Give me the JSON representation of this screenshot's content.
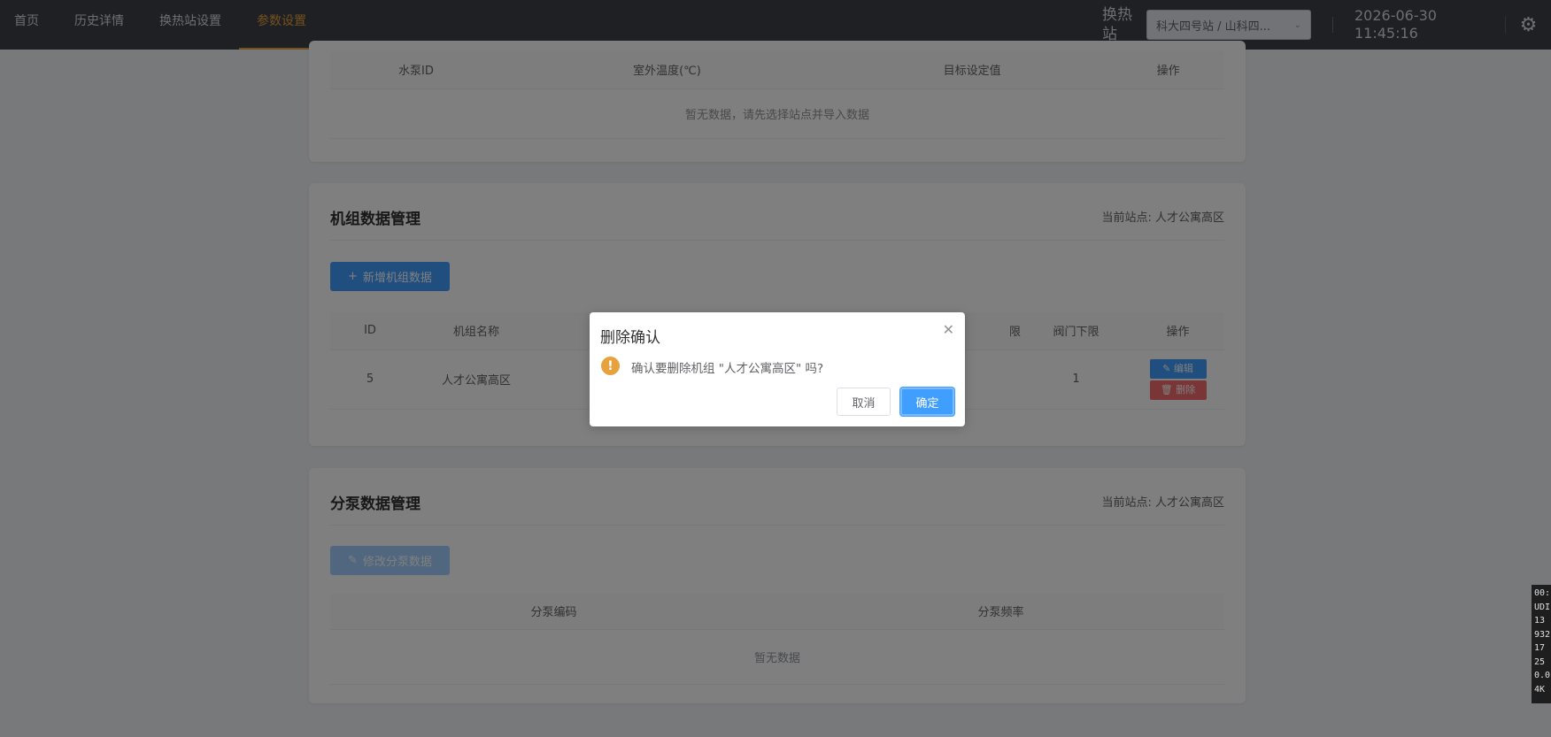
{
  "nav": {
    "items": [
      "首页",
      "历史详情",
      "换热站设置",
      "参数设置"
    ],
    "active_index": 3
  },
  "header": {
    "station_label": "换热站",
    "station_value": "科大四号站 / 山科四...",
    "date": "2026-06-30",
    "time": "11:45:16"
  },
  "pump_table": {
    "columns": [
      "水泵ID",
      "室外温度(℃)",
      "目标设定值",
      "操作"
    ],
    "empty_text": "暂无数据，请先选择站点并导入数据"
  },
  "unit_section": {
    "title": "机组数据管理",
    "site": "当前站点: 人才公寓高区",
    "add_button": "新增机组数据",
    "columns": [
      "ID",
      "机组名称",
      "",
      "",
      "",
      "",
      "限",
      "阀门下限",
      "操作"
    ],
    "rows": [
      {
        "id": "5",
        "name": "人才公寓高区",
        "valve_low": "1",
        "edit": "编辑",
        "delete": "删除"
      }
    ]
  },
  "split_section": {
    "title": "分泵数据管理",
    "site": "当前站点: 人才公寓高区",
    "modify_button": "修改分泵数据",
    "columns": [
      "分泵编码",
      "分泵频率"
    ],
    "empty_text": "暂无数据"
  },
  "dialog": {
    "title": "删除确认",
    "message": "确认要删除机组 \"人才公寓高区\" 吗?",
    "cancel": "取消",
    "confirm": "确定"
  },
  "debug_lines": [
    "00:",
    "UDI",
    "13 ",
    "932",
    "17 ",
    "25 ",
    "0.0",
    "4K "
  ],
  "colors": {
    "topbar": "#3c4148",
    "accent": "#e6a23c",
    "primary": "#409eff",
    "danger": "#f56c6c"
  }
}
